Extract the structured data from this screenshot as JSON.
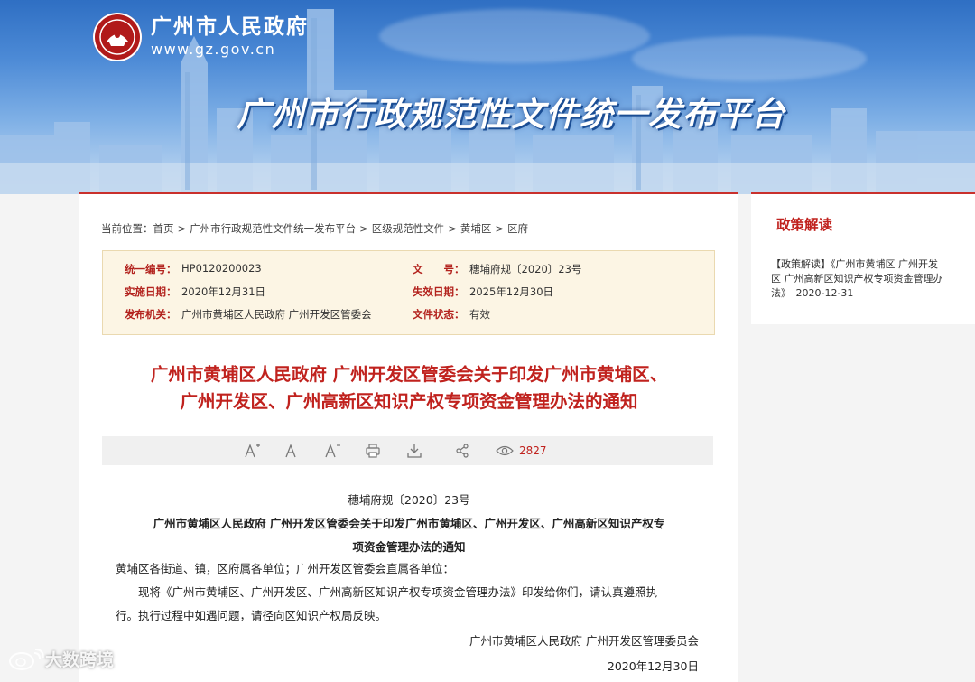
{
  "header": {
    "site_name": "广州市人民政府",
    "site_url": "www.gz.gov.cn",
    "platform_title": "广州市行政规范性文件统一发布平台"
  },
  "breadcrumb": {
    "prefix": "当前位置：",
    "items": [
      "首页",
      "广州市行政规范性文件统一发布平台",
      "区级规范性文件",
      "黄埔区",
      "区府"
    ]
  },
  "meta": {
    "serial_label": "统一编号：",
    "serial_value": "HP0120200023",
    "docno_label": "文　　号：",
    "docno_value": "穗埔府规〔2020〕23号",
    "effective_label": "实施日期：",
    "effective_value": "2020年12月31日",
    "expiry_label": "失效日期：",
    "expiry_value": "2025年12月30日",
    "issuer_label": "发布机关：",
    "issuer_value": "广州市黄埔区人民政府 广州开发区管委会",
    "status_label": "文件状态：",
    "status_value": "有效"
  },
  "document": {
    "title_line1": "广州市黄埔区人民政府 广州开发区管委会关于印发广州市黄埔区、",
    "title_line2": "广州开发区、广州高新区知识产权专项资金管理办法的通知"
  },
  "toolbar": {
    "view_count": "2827"
  },
  "body": {
    "doc_number": "穗埔府规〔2020〕23号",
    "title_line1": "广州市黄埔区人民政府 广州开发区管委会关于印发广州市黄埔区、广州开发区、广州高新区知识产权专",
    "title_line2": "项资金管理办法的通知",
    "addressee": "黄埔区各街道、镇，区府属各单位；广州开发区管委会直属各单位：",
    "para_line1": "　　现将《广州市黄埔区、广州开发区、广州高新区知识产权专项资金管理办法》印发给你们，请认真遵照执",
    "para_line2": "行。执行过程中如遇问题，请径向区知识产权局反映。",
    "signature": "广州市黄埔区人民政府 广州开发区管理委员会",
    "date": "2020年12月30日"
  },
  "sidebar": {
    "title": "政策解读",
    "item_line1": "【政策解读】《广州市黄埔区 广州开发",
    "item_line2": "区 广州高新区知识产权专项资金管理办",
    "item_line3": "法》　2020-12-31"
  },
  "watermark": {
    "text": "大数跨境"
  },
  "colors": {
    "accent_red": "#c0221e",
    "meta_bg": "#fcf5e4",
    "banner_blue": "#2f6fc3"
  },
  "icons": [
    "emblem-icon",
    "font-increase-icon",
    "font-reset-icon",
    "font-decrease-icon",
    "print-icon",
    "download-icon",
    "share-icon",
    "eye-icon",
    "weibo-logo-icon"
  ]
}
